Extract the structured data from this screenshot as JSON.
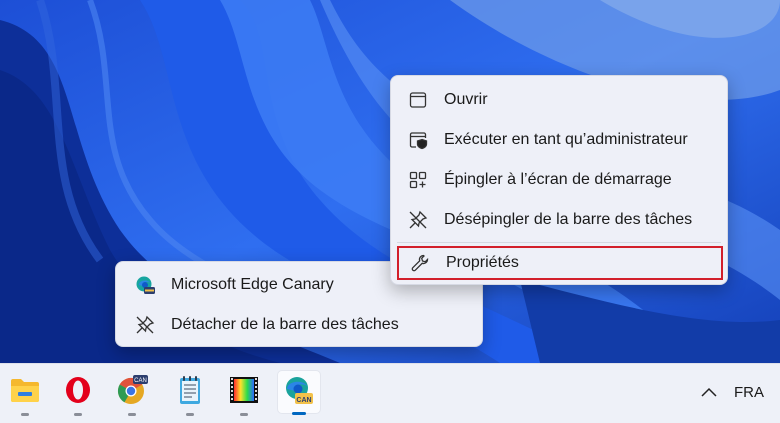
{
  "main_menu": {
    "items": [
      {
        "label": "Ouvrir",
        "icon": "window-icon"
      },
      {
        "label": "Exécuter en tant qu’administrateur",
        "icon": "shield-window-icon"
      },
      {
        "label": "Épingler à l’écran de démarrage",
        "icon": "pin-to-start-icon"
      },
      {
        "label": "Désépingler de la barre des tâches",
        "icon": "unpin-icon"
      }
    ],
    "properties": {
      "label": "Propriétés",
      "icon": "wrench-icon"
    }
  },
  "jump_list": {
    "app": {
      "label": "Microsoft Edge Canary",
      "icon": "edge-canary-icon"
    },
    "unpin": {
      "label": "Détacher de la barre des tâches",
      "icon": "unpin-icon"
    }
  },
  "taskbar": {
    "apps": [
      {
        "name": "file-explorer-icon"
      },
      {
        "name": "opera-icon"
      },
      {
        "name": "chrome-canary-icon"
      },
      {
        "name": "notepad-icon"
      },
      {
        "name": "media-app-icon"
      },
      {
        "name": "edge-canary-icon",
        "active": true
      }
    ],
    "canary_badge": "CAN",
    "chrome_badge": "CAN",
    "language": "FRA"
  },
  "colors": {
    "highlight_border": "#d21f2b",
    "menu_bg": "#eef0f8",
    "taskbar_bg": "#eef1f8",
    "accent": "#0067c0"
  }
}
